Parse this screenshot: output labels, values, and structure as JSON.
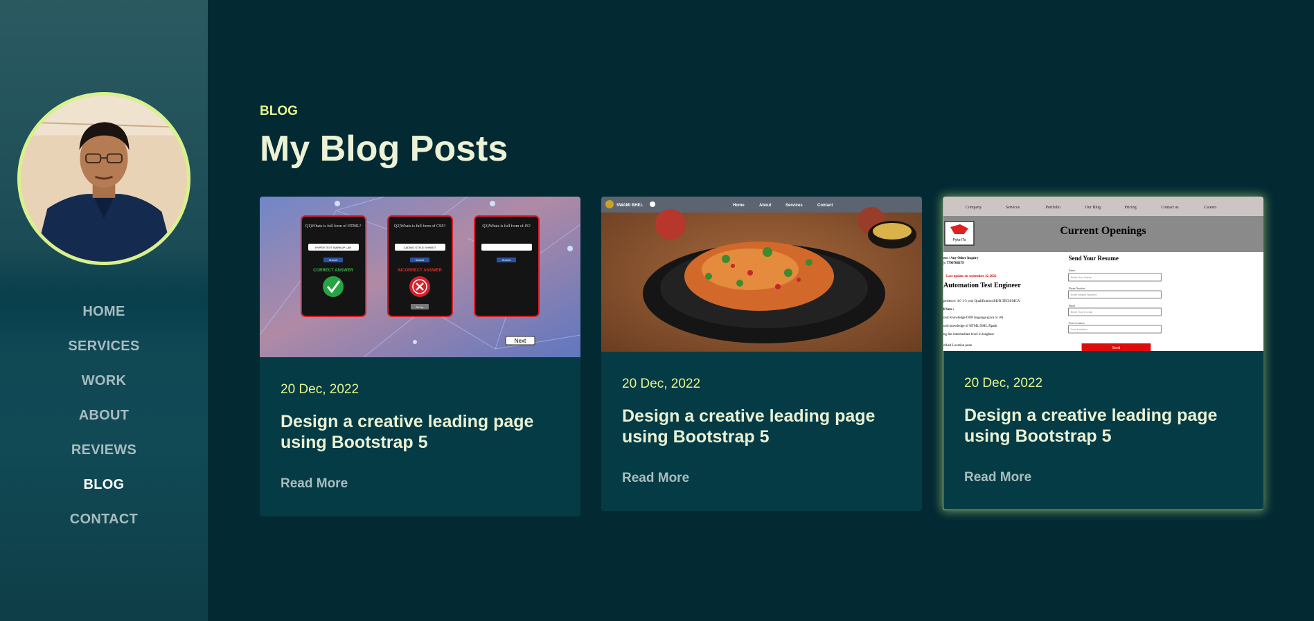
{
  "sidebar": {
    "nav": [
      {
        "label": "HOME"
      },
      {
        "label": "SERVICES"
      },
      {
        "label": "WORK"
      },
      {
        "label": "ABOUT"
      },
      {
        "label": "REVIEWS"
      },
      {
        "label": "BLOG",
        "active": true
      },
      {
        "label": "CONTACT"
      }
    ]
  },
  "section": {
    "eyebrow": "BLOG",
    "heading": "My Blog Posts"
  },
  "posts": [
    {
      "date": "20 Dec, 2022",
      "title": "Design a creative leading page using Bootstrap 5",
      "read_more": "Read More",
      "thumb": {
        "q1": "Q1)Whats is full form of HTML?",
        "q1_answer": "HYPER TEXT MARKUP LAN",
        "q2": "Q2)Whats is full form of CSS?",
        "q2_answer": "CADING STYLE SHHEET",
        "q3": "Q3)Whats is full form of JS?",
        "submit": "Submit",
        "correct": "CORRECT ANSWER",
        "incorrect": "INCORRECT ANSWER",
        "retry": "Re-try",
        "next": "Next"
      }
    },
    {
      "date": "20 Dec, 2022",
      "title": "Design a creative leading page using Bootstrap 5",
      "read_more": "Read More",
      "thumb": {
        "brand": "SWAMI BHEL",
        "nav": [
          "Home",
          "About",
          "Services",
          "Contact"
        ]
      }
    },
    {
      "date": "20 Dec, 2022",
      "title": "Design a creative leading page using Bootstrap 5",
      "read_more": "Read More",
      "thumb": {
        "nav": [
          "Company",
          "Services",
          "Portfolio",
          "Our Blog",
          "Pricing",
          "Contact us",
          "Careers"
        ],
        "heading": "Current Openings",
        "logo": "Pyke ITs",
        "left_lines": [
          "eer / Any Other Inquiry",
          "): 7796788379",
          "Last update on september 22 2022",
          "Automation Test Engineer",
          "perience: 4 0 1-3 year Qualification:BE/B.TECH/MCA",
          "ll Sets :",
          "ood Knowledge OOP language (java or c#)",
          "ood knowledge of HTML/XML/Xpath",
          "ng Ide intermediate level in langbasc",
          "orked  Location pune"
        ],
        "form_title": "Send Your Resume",
        "fields": [
          {
            "label": "Name",
            "placeholder": "Enter Your Name"
          },
          {
            "label": "Phone Number",
            "placeholder": "Enter Mobile Number"
          },
          {
            "label": "Email",
            "placeholder": "Enter Your E-mail"
          },
          {
            "label": "Your Location",
            "placeholder": "Your Location"
          }
        ],
        "send": "Send"
      }
    }
  ],
  "colors": {
    "background": "#032a33",
    "accent": "#e6f58e",
    "card": "#053b45",
    "avatar_ring": "#d9f18b"
  }
}
